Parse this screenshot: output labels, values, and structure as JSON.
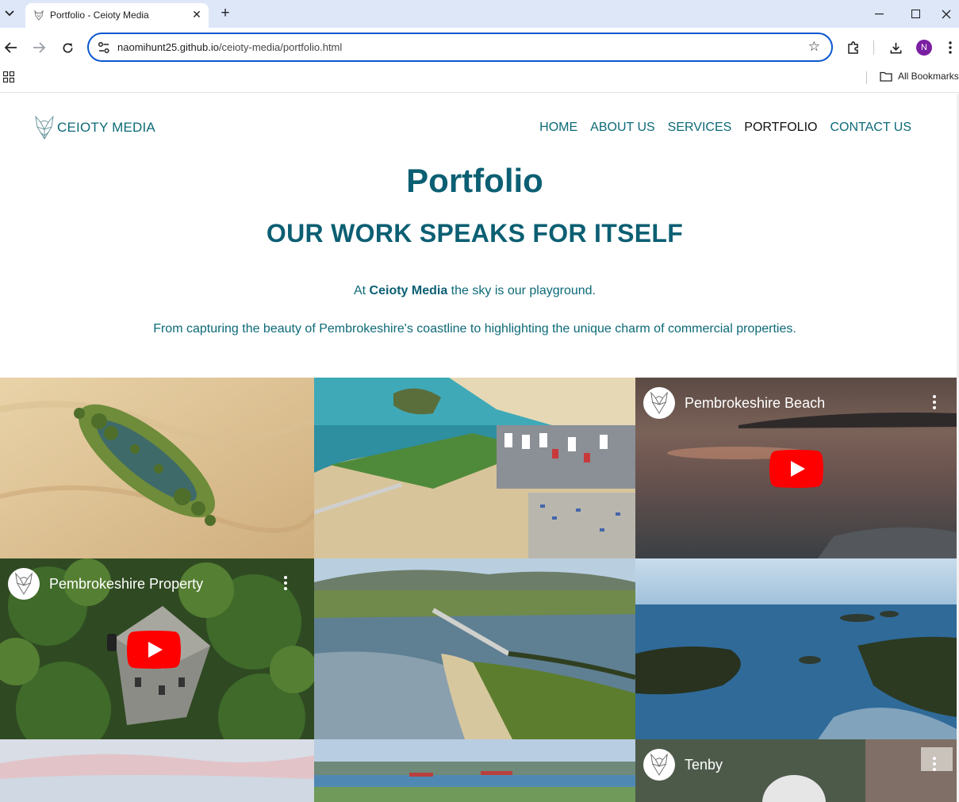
{
  "browser": {
    "tab_title": "Portfolio - Ceioty Media",
    "url_host": "naomihunt25.github.io",
    "url_path": "/ceioty-media/portfolio.html",
    "profile_initial": "N",
    "all_bookmarks": "All Bookmarks",
    "icons": [
      "tab-search-icon",
      "close-icon",
      "new-tab-icon",
      "minimize-icon",
      "maximize-icon",
      "window-close-icon",
      "back-icon",
      "forward-icon",
      "reload-icon",
      "site-info-icon",
      "star-icon",
      "extensions-icon",
      "download-icon",
      "menu-icon",
      "apps-icon",
      "folder-icon"
    ]
  },
  "site": {
    "logo_text": "CEIOTY MEDIA",
    "nav": [
      {
        "label": "HOME",
        "active": false
      },
      {
        "label": "ABOUT US",
        "active": false
      },
      {
        "label": "SERVICES",
        "active": false
      },
      {
        "label": "PORTFOLIO",
        "active": true
      },
      {
        "label": "CONTACT US",
        "active": false
      }
    ],
    "accent_color": "#0c6a78"
  },
  "main": {
    "title": "Portfolio",
    "subtitle": "OUR WORK SPEAKS FOR ITSELF",
    "intro_before": "At ",
    "intro_brand": "Ceioty Media",
    "intro_after": " the sky is our playground.",
    "intro2": "From capturing the beauty of Pembrokeshire's coastline to highlighting the unique charm of commercial properties."
  },
  "gallery": {
    "videos": [
      {
        "title": "Pembrokeshire Beach"
      },
      {
        "title": "Pembrokeshire Property"
      },
      {
        "title": "Tenby"
      }
    ]
  }
}
